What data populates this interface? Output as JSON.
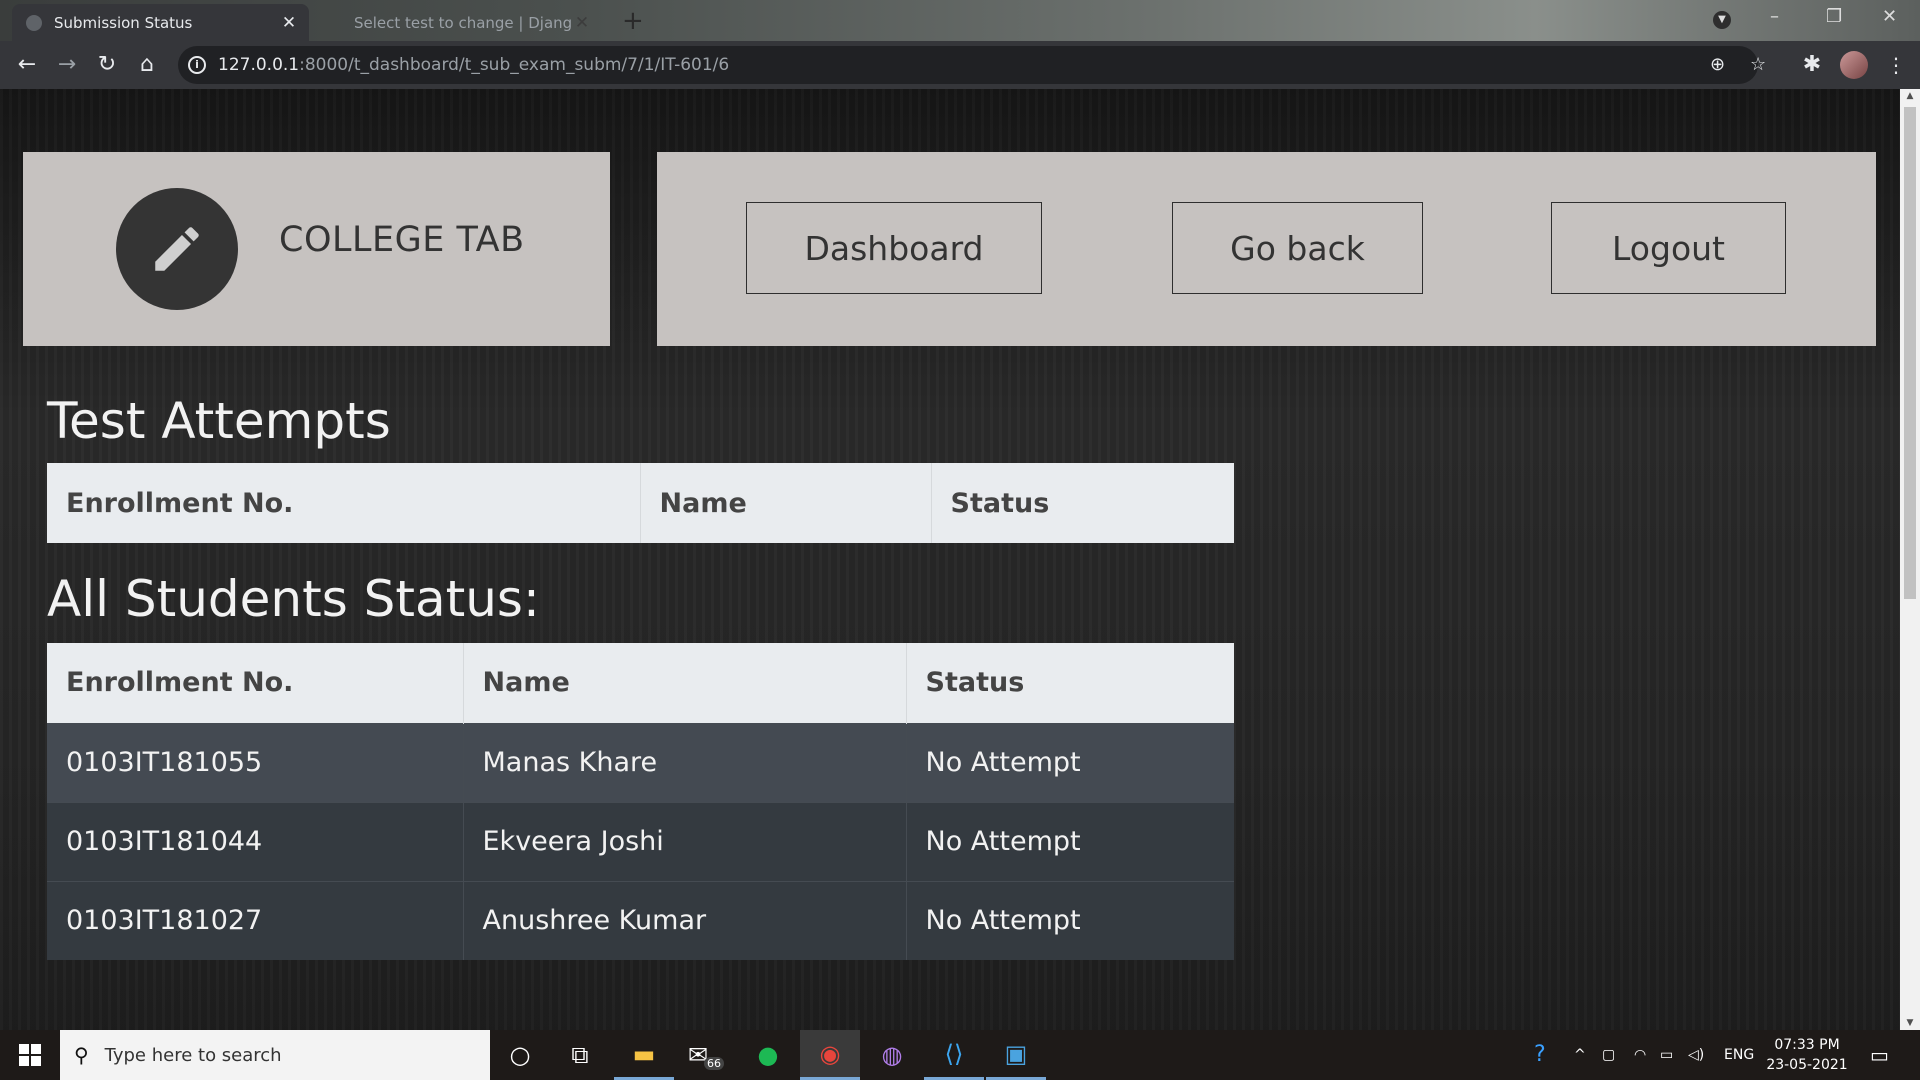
{
  "browser": {
    "tabs": [
      {
        "title": "Submission Status",
        "active": true
      },
      {
        "title": "Select test to change | Django si",
        "active": false
      }
    ],
    "url": {
      "host": "127.0.0.1",
      "path": ":8000/t_dashboard/t_sub_exam_subm/7/1/IT-601/6"
    }
  },
  "header": {
    "brand": "COLLEGE TAB",
    "nav": {
      "dashboard": "Dashboard",
      "go_back": "Go back",
      "logout": "Logout"
    }
  },
  "test_attempts": {
    "title": "Test Attempts",
    "columns": [
      "Enrollment No.",
      "Name",
      "Status"
    ]
  },
  "all_students": {
    "title": "All Students Status:",
    "columns": [
      "Enrollment No.",
      "Name",
      "Status"
    ],
    "rows": [
      [
        "0103IT181055",
        "Manas Khare",
        "No Attempt"
      ],
      [
        "0103IT181044",
        "Ekveera Joshi",
        "No Attempt"
      ],
      [
        "0103IT181027",
        "Anushree Kumar",
        "No Attempt"
      ]
    ]
  },
  "taskbar": {
    "search_placeholder": "Type here to search",
    "mail_badge": "66",
    "language": "ENG",
    "time": "07:33 PM",
    "date": "23-05-2021"
  }
}
